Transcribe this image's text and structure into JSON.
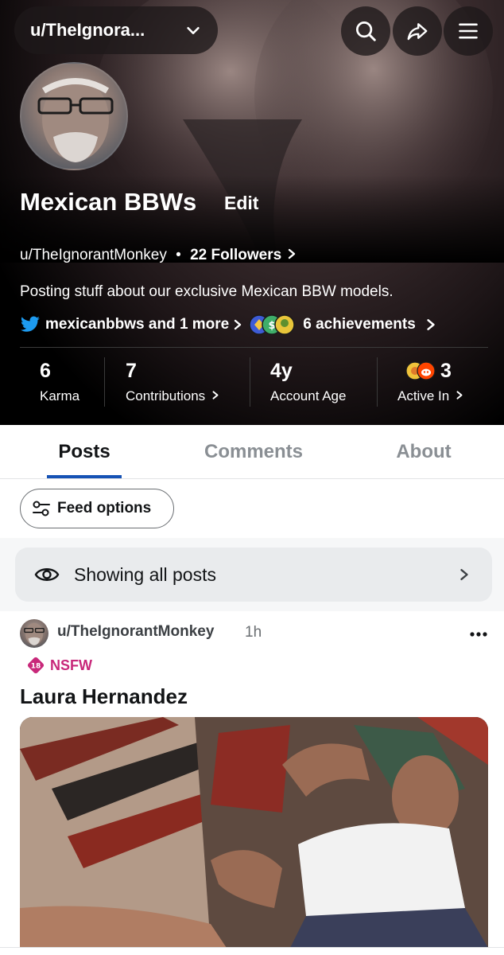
{
  "nav": {
    "username_short": "u/TheIgnora...",
    "icons": [
      "chevron-down-icon",
      "search-icon",
      "share-icon",
      "menu-icon"
    ]
  },
  "profile": {
    "display_name": "Mexican BBWs",
    "edit_label": "Edit",
    "username": "u/TheIgnorantMonkey",
    "separator": "•",
    "followers_label": "22 Followers",
    "bio": "Posting stuff about our exclusive Mexican BBW models.",
    "social_link": "mexicanbbws and 1 more",
    "achievements_label": "6 achievements"
  },
  "stats": [
    {
      "value": "6",
      "label": "Karma"
    },
    {
      "value": "7",
      "label": "Contributions"
    },
    {
      "value": "4y",
      "label": "Account Age"
    },
    {
      "value": "3",
      "label": "Active In"
    }
  ],
  "tabs": [
    "Posts",
    "Comments",
    "About"
  ],
  "active_tab": "Posts",
  "feed": {
    "options_label": "Feed options",
    "showing_label": "Showing all posts"
  },
  "post": {
    "author": "u/TheIgnorantMonkey",
    "time": "1h",
    "nsfw_badge_number": "18",
    "nsfw_label": "NSFW",
    "title": "Laura Hernandez"
  },
  "colors": {
    "accent_underline": "#1652b5",
    "nsfw": "#c8287a",
    "twitter": "#1d9bf0",
    "header_bg": "#000000"
  }
}
